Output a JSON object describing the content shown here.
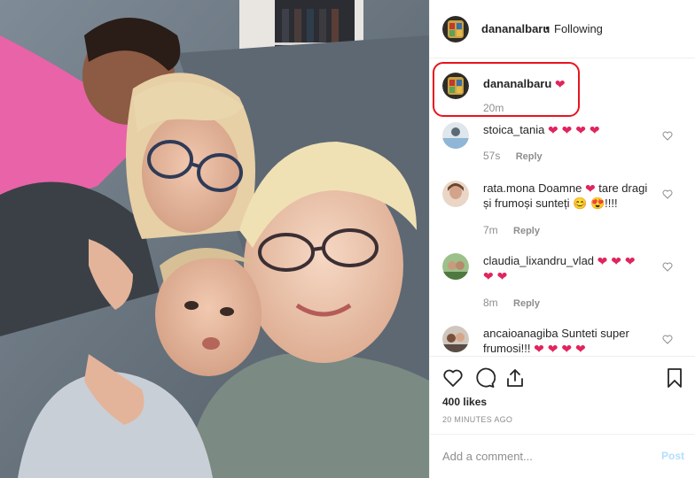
{
  "header": {
    "username": "dananalbaru",
    "separator": "•",
    "follow_status": "Following"
  },
  "caption": {
    "username": "dananalbaru",
    "heart": "❤",
    "time": "20m"
  },
  "comments": [
    {
      "username": "stoica_tania",
      "text": "",
      "hearts": "❤ ❤ ❤ ❤",
      "time": "57s",
      "reply": "Reply"
    },
    {
      "username": "rata.mona",
      "text_before": "Doamne",
      "heart_inline": "❤",
      "text_after": "tare dragi",
      "line2": "și frumoși sunteți",
      "emoji": "😊 😍",
      "suffix": "!!!!",
      "time": "7m",
      "reply": "Reply"
    },
    {
      "username": "claudia_lixandru_vlad",
      "hearts": "❤ ❤ ❤",
      "hearts2": "❤ ❤",
      "time": "8m",
      "reply": "Reply"
    },
    {
      "username": "ancaioanagiba",
      "text": "Sunteti super",
      "line2": "frumosi!!!",
      "hearts": "❤ ❤ ❤ ❤"
    }
  ],
  "actions": {
    "icons": [
      "heart-outline",
      "comment-bubble",
      "share-arrow",
      "bookmark"
    ],
    "likes": "400 likes",
    "time_ago": "20 MINUTES AGO"
  },
  "add_comment": {
    "placeholder": "Add a comment...",
    "post_label": "Post"
  },
  "colors": {
    "heart_red": "#e0245e",
    "annotation_red": "#e8141e",
    "muted": "#8e8e8e",
    "post_disabled": "#b2dffc"
  }
}
